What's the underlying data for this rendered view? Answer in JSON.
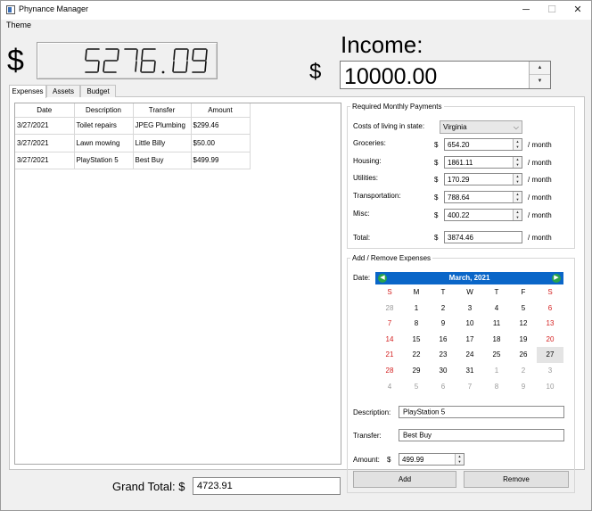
{
  "window": {
    "title": "Phynance Manager",
    "minimize": "─",
    "maximize": "☐",
    "close": "✕"
  },
  "menu": {
    "theme": "Theme"
  },
  "dollar_left": "$",
  "dollar_income": "$",
  "lcd_value": "5276.09",
  "income": {
    "label": "Income:",
    "value": "10000.00"
  },
  "tabs": [
    {
      "label": "Expenses",
      "active": true
    },
    {
      "label": "Assets",
      "active": false
    },
    {
      "label": "Budget",
      "active": false
    }
  ],
  "expenses": {
    "columns": [
      "Date",
      "Description",
      "Transfer",
      "Amount"
    ],
    "rows": [
      [
        "3/27/2021",
        "Toilet repairs",
        "JPEG Plumbing",
        "$299.46"
      ],
      [
        "3/27/2021",
        "Lawn mowing",
        "Little Billy",
        "$50.00"
      ],
      [
        "3/27/2021",
        "PlayStation 5",
        "Best Buy",
        "$499.99"
      ]
    ]
  },
  "grand_total": {
    "label": "Grand Total: $",
    "value": "4723.91"
  },
  "monthly": {
    "title": "Required Monthly Payments",
    "state_label": "Costs of living in state:",
    "state_value": "Virginia",
    "currency": "$",
    "per_month": "/ month",
    "items": [
      {
        "label": "Groceries:",
        "value": "654.20"
      },
      {
        "label": "Housing:",
        "value": "1861.11"
      },
      {
        "label": "Utilities:",
        "value": "170.29"
      },
      {
        "label": "Transportation:",
        "value": "788.64"
      },
      {
        "label": "Misc:",
        "value": "400.22"
      }
    ],
    "total_label": "Total:",
    "total_value": "3874.46"
  },
  "editor": {
    "title": "Add / Remove Expenses",
    "date_label": "Date:",
    "calendar": {
      "month_year": "March,   2021",
      "weekdays": [
        "S",
        "M",
        "T",
        "W",
        "T",
        "F",
        "S"
      ],
      "weeks": [
        [
          "28",
          "1",
          "2",
          "3",
          "4",
          "5",
          "6"
        ],
        [
          "7",
          "8",
          "9",
          "10",
          "11",
          "12",
          "13"
        ],
        [
          "14",
          "15",
          "16",
          "17",
          "18",
          "19",
          "20"
        ],
        [
          "21",
          "22",
          "23",
          "24",
          "25",
          "26",
          "27"
        ],
        [
          "28",
          "29",
          "30",
          "31",
          "1",
          "2",
          "3"
        ],
        [
          "4",
          "5",
          "6",
          "7",
          "8",
          "9",
          "10"
        ]
      ],
      "selected": "27"
    },
    "description_label": "Description:",
    "description_value": "PlayStation 5",
    "transfer_label": "Transfer:",
    "transfer_value": "Best Buy",
    "amount_label": "Amount:",
    "amount_currency": "$",
    "amount_value": "499.99",
    "add_label": "Add",
    "remove_label": "Remove"
  },
  "colors": {
    "calendar_header": "#0a66c8",
    "weekend_red": "#d42020",
    "other_month_gray": "#9a9a9a",
    "selected_day_bg": "#e4e4e4"
  }
}
